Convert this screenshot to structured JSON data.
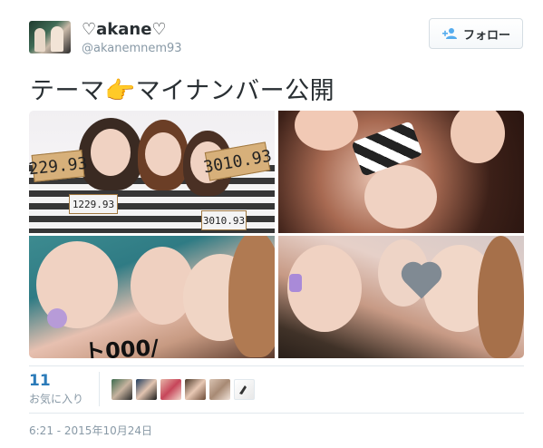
{
  "user": {
    "display_name": "♡akane♡",
    "screen_name": "@akanemnem93"
  },
  "follow_button": {
    "label": "フォロー",
    "icon": "add-person-icon"
  },
  "tweet": {
    "text": "テーマ👉マイナンバー公開"
  },
  "photos": [
    {
      "signs": [
        "229.93",
        "3010.93",
        "1229.93",
        "3010.93"
      ]
    },
    {},
    {
      "overlay_text": "ト000/"
    },
    {}
  ],
  "stats": {
    "favorites_count": "11",
    "favorites_label": "お気に入り"
  },
  "timestamp": "6:21 - 2015年10月24日",
  "colors": {
    "link": "#2b7bb9",
    "muted": "#8899a6",
    "text": "#292f33",
    "border": "#e1e8ed"
  }
}
